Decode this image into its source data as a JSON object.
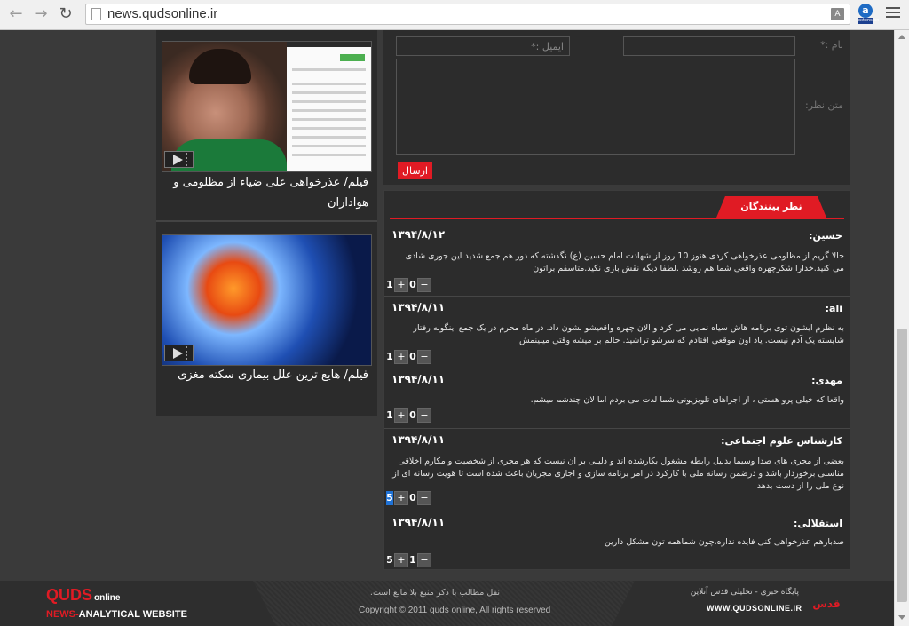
{
  "browser": {
    "url": "news.qudsonline.ir",
    "ext_label": "a",
    "ext_tag": "extension"
  },
  "videos": [
    {
      "caption": "فیلم/ عذرخواهی علی ضیاء از مظلومی و هواداران"
    },
    {
      "caption": "فیلم/ هایع ترین علل بیماری سکته مغزی"
    }
  ],
  "form": {
    "name_label": "نام :*",
    "email_label": "ایمیل :*",
    "comment_label": "متن نظر:",
    "submit_label": "ارسال"
  },
  "comments_section": {
    "tab_label": "نظر بینندگان",
    "comments": [
      {
        "name": "حسین:",
        "date": "۱۳۹۴/۸/۱۲",
        "text": "حالا گریم از مظلومی عذرخواهی کردی هنوز 10 روز از شهادت امام حسین (ع) نگذشته که دور هم جمع شدید این جوری شادی می کنید.خدارا شکرچهره واقعی شما هم روشد .لطفا دیگه نقش بازی نکید.متاسفم براتون",
        "votes_down": "0",
        "votes_up": "1"
      },
      {
        "name": "ali:",
        "date": "۱۳۹۴/۸/۱۱",
        "text": "به نظرم ایشون توی برنامه هاش سیاه نمایی می کرد و الان چهره واقعیشو نشون داد. در ماه محرم در یک جمع اینگونه رفتار شایسته یک آدم نیست. یاد اون موقعی افتادم که سرشو تراشید. حالم بر میشه وقتی میبینمش.",
        "votes_down": "0",
        "votes_up": "1"
      },
      {
        "name": "مهدی:",
        "date": "۱۳۹۴/۸/۱۱",
        "text": "واقعا که خیلی پرو هستی ، از اجراهای تلویزیونی شما لذت می بردم اما لان چندشم میشم.",
        "votes_down": "0",
        "votes_up": "1"
      },
      {
        "name": "کارشناس علوم اجتماعی:",
        "date": "۱۳۹۴/۸/۱۱",
        "text": "بعضی از مجری های صدا وسیما بدلیل رابطه مشغول بکارشده اند و دلیلی بر آن نیست که هر مجری از شخصیت و مکارم اخلاقی مناسبی برخوردار باشد و درضمن رسانه ملی با کارکرد در امر برنامه سازی و اجاری مجریان باعث شده است تا هویت رسانه ای از نوع ملی را از دست بدهد",
        "votes_down": "0",
        "votes_up": "5"
      },
      {
        "name": "استقلالی:",
        "date": "۱۳۹۴/۸/۱۱",
        "text": "صدبارهم عذرخواهی کنی فایده نداره،چون شماهمه تون مشکل دارین",
        "votes_down": "1",
        "votes_up": "5"
      }
    ]
  },
  "footer": {
    "logo_main": "QUDS",
    "logo_sub": "online",
    "tagline_en_1": "NEWS-",
    "tagline_en_2": "ANALYTICAL WEBSITE",
    "copy_fa": "نقل مطالب با ذکر منبع بلا مانع است.",
    "copyright": "Copyright © 2011 quds online, All rights reserved",
    "site_fa": "پایگاه خبری - تحلیلی قدس آنلاین",
    "site_url": "WWW.QUDSONLINE.IR",
    "brand_fa": "قدس آنلاین"
  }
}
